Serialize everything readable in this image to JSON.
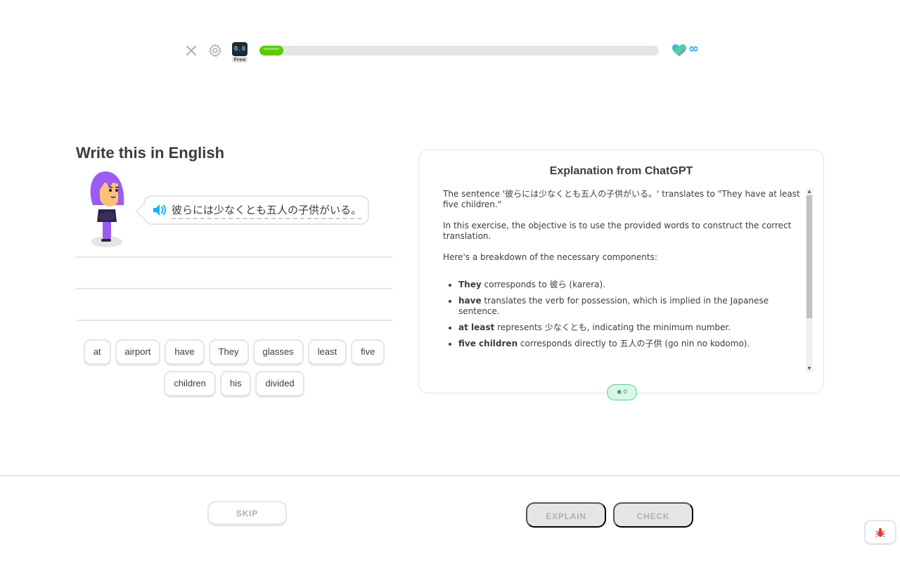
{
  "topbar": {
    "close_icon": "close-icon",
    "settings_icon": "gear-icon",
    "badge": {
      "face": "0.0",
      "label": "Free"
    },
    "progress": 0.06,
    "progress_color": "#58cc02",
    "hearts_icon": "heart-icon",
    "hearts_value": "∞"
  },
  "exercise": {
    "title": "Write this in English",
    "prompt": "彼らには少なくとも五人の子供がいる。",
    "speaker_icon": "speaker-icon",
    "word_bank": [
      [
        "at",
        "airport",
        "have",
        "They",
        "glasses",
        "least",
        "five"
      ],
      [
        "children",
        "his",
        "divided"
      ]
    ]
  },
  "explanation": {
    "title": "Explanation from ChatGPT",
    "paragraphs": [
      "The sentence '彼らには少なくとも五人の子供がいる。' translates to \"They have at least five children.\"",
      "In this exercise, the objective is to use the provided words to construct the correct translation.",
      "Here's a breakdown of the necessary components:"
    ],
    "items": [
      {
        "bold": "They",
        "text": " corresponds to 彼ら (karera)."
      },
      {
        "bold": "have",
        "text": " translates the verb for possession, which is implied in the Japanese sentence."
      },
      {
        "bold": "at least",
        "text": " represents 少なくとも, indicating the minimum number."
      },
      {
        "bold": "five children",
        "text": " corresponds directly to 五人の子供 (go nin no kodomo)."
      }
    ],
    "token_count": "0"
  },
  "footer": {
    "skip_label": "SKIP",
    "explain_label": "EXPLAIN",
    "check_label": "CHECK",
    "bug_icon": "bug-icon"
  },
  "colors": {
    "accent_green": "#58cc02",
    "border": "#e5e5e5",
    "disabled_text": "#afafaf",
    "character_purple": "#9b5cf0"
  }
}
